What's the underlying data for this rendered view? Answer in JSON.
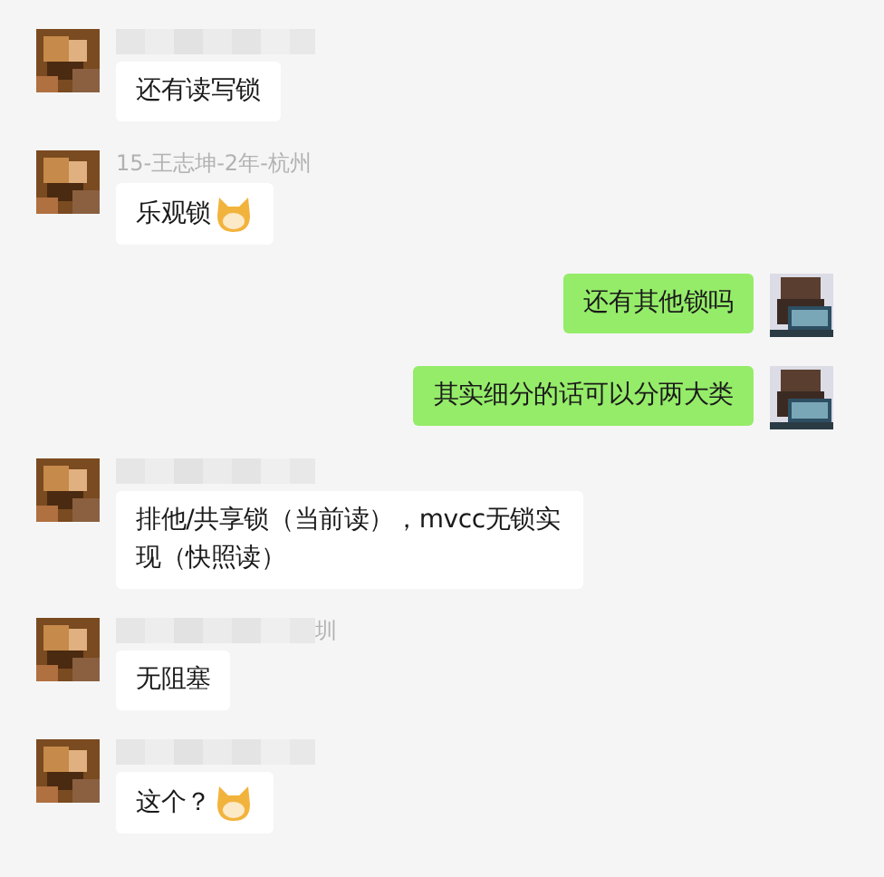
{
  "messages": [
    {
      "kind": "received",
      "sender": {
        "hidden": true
      },
      "text": "还有读写锁",
      "emoji": false
    },
    {
      "kind": "received",
      "sender": {
        "hidden": false,
        "name": "15-王志坤-2年-杭州"
      },
      "text": "乐观锁",
      "emoji": true
    },
    {
      "kind": "sent",
      "text": "还有其他锁吗",
      "emoji": false
    },
    {
      "kind": "sent",
      "text": "其实细分的话可以分两大类",
      "emoji": false
    },
    {
      "kind": "received",
      "sender": {
        "hidden": true
      },
      "text": "排他/共享锁（当前读），mvcc无锁实现（快照读）",
      "emoji": false
    },
    {
      "kind": "received",
      "sender": {
        "hidden": true,
        "name": "圳"
      },
      "text": "无阻塞",
      "emoji": false
    },
    {
      "kind": "received",
      "sender": {
        "hidden": true
      },
      "text": "这个？",
      "emoji": true
    }
  ]
}
